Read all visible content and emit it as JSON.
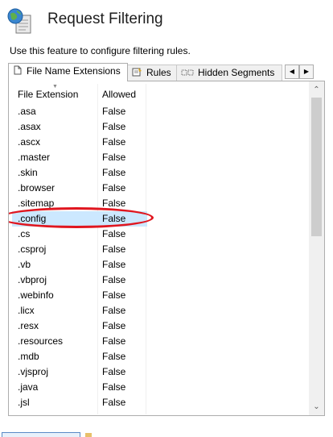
{
  "header": {
    "title": "Request Filtering",
    "description": "Use this feature to configure filtering rules.",
    "icon": "globe-filter-icon"
  },
  "tabs": [
    {
      "label": "File Name Extensions",
      "icon": "document-icon",
      "active": true
    },
    {
      "label": "Rules",
      "icon": "rules-icon",
      "active": false
    },
    {
      "label": "Hidden Segments",
      "icon": "hidden-segments-icon",
      "active": false
    }
  ],
  "table": {
    "columns": [
      "File Extension",
      "Allowed"
    ],
    "rows": [
      {
        "ext": ".asa",
        "allowed": "False"
      },
      {
        "ext": ".asax",
        "allowed": "False"
      },
      {
        "ext": ".ascx",
        "allowed": "False"
      },
      {
        "ext": ".master",
        "allowed": "False"
      },
      {
        "ext": ".skin",
        "allowed": "False"
      },
      {
        "ext": ".browser",
        "allowed": "False"
      },
      {
        "ext": ".sitemap",
        "allowed": "False"
      },
      {
        "ext": ".config",
        "allowed": "False",
        "selected": true
      },
      {
        "ext": ".cs",
        "allowed": "False"
      },
      {
        "ext": ".csproj",
        "allowed": "False"
      },
      {
        "ext": ".vb",
        "allowed": "False"
      },
      {
        "ext": ".vbproj",
        "allowed": "False"
      },
      {
        "ext": ".webinfo",
        "allowed": "False"
      },
      {
        "ext": ".licx",
        "allowed": "False"
      },
      {
        "ext": ".resx",
        "allowed": "False"
      },
      {
        "ext": ".resources",
        "allowed": "False"
      },
      {
        "ext": ".mdb",
        "allowed": "False"
      },
      {
        "ext": ".vjsproj",
        "allowed": "False"
      },
      {
        "ext": ".java",
        "allowed": "False"
      },
      {
        "ext": ".jsl",
        "allowed": "False"
      }
    ]
  },
  "colors": {
    "selected_row": "#cce8ff",
    "annotation": "#e0161f",
    "border": "#adadad",
    "scrollbar_thumb": "#cdcdcd"
  }
}
